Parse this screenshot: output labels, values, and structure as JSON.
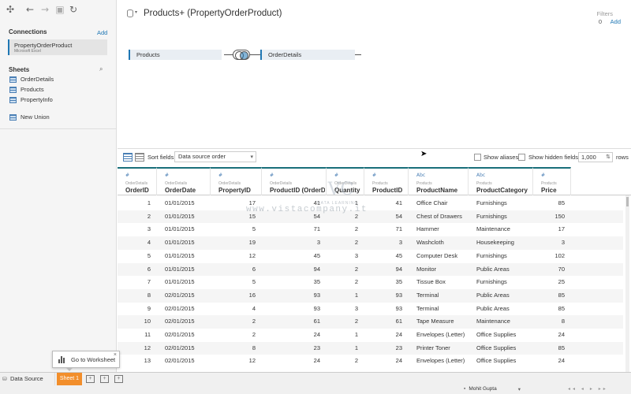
{
  "toolbar": {
    "logo_icon": "tableau-logo-icon",
    "back_icon": "←",
    "forward_icon": "→",
    "save_icon": "▣",
    "refresh_icon": "↻"
  },
  "connections": {
    "title": "Connections",
    "add_label": "Add",
    "items": [
      {
        "name": "PropertyOrderProduct",
        "type": "Microsoft Excel"
      }
    ]
  },
  "sheets": {
    "title": "Sheets",
    "search_icon": "search-icon",
    "items": [
      "OrderDetails",
      "Products",
      "PropertyInfo"
    ],
    "new_union": "New Union"
  },
  "canvas": {
    "title": "Products+ (PropertyOrderProduct)",
    "filters_label": "Filters",
    "filters_count": "0",
    "filters_add": "Add",
    "left_table": "Products",
    "right_table": "OrderDetails"
  },
  "gridbar": {
    "sort_label": "Sort fields",
    "sort_value": "Data source order",
    "show_aliases": "Show aliases",
    "show_hidden": "Show hidden fields",
    "rows_value": "1,000",
    "rows_label": "rows"
  },
  "columns": [
    {
      "src": "OrderDetails",
      "name": "OrderID",
      "type": "#",
      "align": "num"
    },
    {
      "src": "OrderDetails",
      "name": "OrderDate",
      "type": "#",
      "align": "left"
    },
    {
      "src": "OrderDetails",
      "name": "PropertyID",
      "type": "#",
      "align": "num"
    },
    {
      "src": "OrderDetails",
      "name": "ProductID (OrderD...",
      "type": "#",
      "align": "num"
    },
    {
      "src": "OrderDetails",
      "name": "Quantity",
      "type": "#",
      "align": "num"
    },
    {
      "src": "Products",
      "name": "ProductID",
      "type": "#",
      "align": "num"
    },
    {
      "src": "Products",
      "name": "ProductName",
      "type": "Abc",
      "align": "left"
    },
    {
      "src": "Products",
      "name": "ProductCategory",
      "type": "Abc",
      "align": "left"
    },
    {
      "src": "Products",
      "name": "Price",
      "type": "#",
      "align": "num"
    }
  ],
  "rows": [
    [
      "1",
      "01/01/2015",
      "17",
      "41",
      "1",
      "41",
      "Office Chair",
      "Furnishings",
      "85"
    ],
    [
      "2",
      "01/01/2015",
      "15",
      "54",
      "2",
      "54",
      "Chest of Drawers",
      "Furnishings",
      "150"
    ],
    [
      "3",
      "01/01/2015",
      "5",
      "71",
      "2",
      "71",
      "Hammer",
      "Maintenance",
      "17"
    ],
    [
      "4",
      "01/01/2015",
      "19",
      "3",
      "2",
      "3",
      "Washcloth",
      "Housekeeping",
      "3"
    ],
    [
      "5",
      "01/01/2015",
      "12",
      "45",
      "3",
      "45",
      "Computer Desk",
      "Furnishings",
      "102"
    ],
    [
      "6",
      "01/01/2015",
      "6",
      "94",
      "2",
      "94",
      "Monitor",
      "Public Areas",
      "70"
    ],
    [
      "7",
      "01/01/2015",
      "5",
      "35",
      "2",
      "35",
      "Tissue Box",
      "Furnishings",
      "25"
    ],
    [
      "8",
      "02/01/2015",
      "16",
      "93",
      "1",
      "93",
      "Terminal",
      "Public Areas",
      "85"
    ],
    [
      "9",
      "02/01/2015",
      "4",
      "93",
      "3",
      "93",
      "Terminal",
      "Public Areas",
      "85"
    ],
    [
      "10",
      "02/01/2015",
      "2",
      "61",
      "2",
      "61",
      "Tape Measure",
      "Maintenance",
      "8"
    ],
    [
      "11",
      "02/01/2015",
      "2",
      "24",
      "1",
      "24",
      "Envelopes (Letter)",
      "Office Supplies",
      "24"
    ],
    [
      "12",
      "02/01/2015",
      "8",
      "23",
      "1",
      "23",
      "Printer Toner",
      "Office Supplies",
      "85"
    ],
    [
      "13",
      "02/01/2015",
      "12",
      "24",
      "2",
      "24",
      "Envelopes (Letter)",
      "Office Supplies",
      "24"
    ]
  ],
  "watermark": {
    "logo": "VC",
    "small": "DATA LEARNING",
    "url": "www.vistacompany.it"
  },
  "bottom": {
    "data_source_tab": "Data Source",
    "sheet_tab": "Sheet 1",
    "tooltip_label": "Go to Worksheet",
    "tooltip_close": "×",
    "user_name": "Mohit Gupta",
    "nav_arrows": "◂◂ ◂ ▸ ▸▸"
  }
}
